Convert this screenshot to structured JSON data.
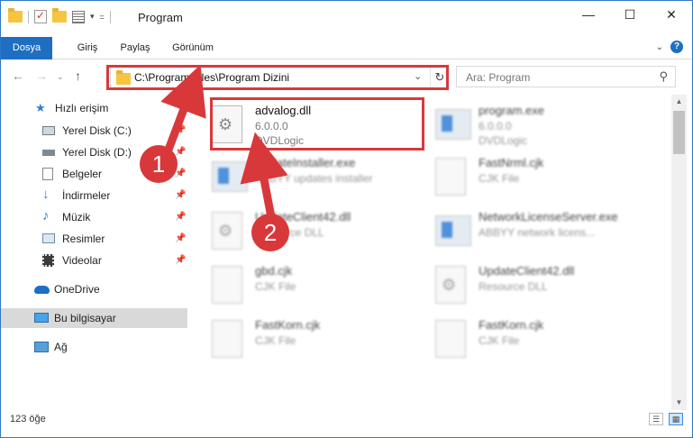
{
  "window": {
    "title": "Program"
  },
  "ribbon": {
    "tabs": [
      "Dosya",
      "Giriş",
      "Paylaş",
      "Görünüm"
    ]
  },
  "address": {
    "path": "C:\\Program Files\\Program Dizini"
  },
  "search": {
    "placeholder": "Ara: Program"
  },
  "sidebar": {
    "items": [
      {
        "label": "Hızlı erişim"
      },
      {
        "label": "Yerel Disk (C:)"
      },
      {
        "label": "Yerel Disk (D:)"
      },
      {
        "label": "Belgeler"
      },
      {
        "label": "İndirmeler"
      },
      {
        "label": "Müzik"
      },
      {
        "label": "Resimler"
      },
      {
        "label": "Videolar"
      },
      {
        "label": "OneDrive"
      },
      {
        "label": "Bu bilgisayar"
      },
      {
        "label": "Ağ"
      }
    ]
  },
  "files": [
    {
      "name": "advalog.dll",
      "line1": "6.0.0.0",
      "line2": "DVDLogic",
      "icon": "dll-icon"
    },
    {
      "name": "program.exe",
      "line1": "6.0.0.0",
      "line2": "DVDLogic",
      "icon": "exe-icon"
    },
    {
      "name": "UpdateInstaller.exe",
      "line1": "ABBYY updates installer",
      "line2": "",
      "icon": "exe-icon"
    },
    {
      "name": "FastNrml.cjk",
      "line1": "CJK File",
      "line2": "",
      "icon": "file-icon"
    },
    {
      "name": "UpdateClient42.dll",
      "line1": "Resource DLL",
      "line2": "",
      "icon": "dll-icon"
    },
    {
      "name": "NetworkLicenseServer.exe",
      "line1": "ABBYY network licens...",
      "line2": "",
      "icon": "exe-icon"
    },
    {
      "name": "gbd.cjk",
      "line1": "CJK File",
      "line2": "",
      "icon": "file-icon"
    },
    {
      "name": "UpdateClient42.dll",
      "line1": "Resource DLL",
      "line2": "",
      "icon": "dll-icon"
    },
    {
      "name": "FastKorn.cjk",
      "line1": "CJK File",
      "line2": "",
      "icon": "file-icon"
    },
    {
      "name": "FastKorn.cjk",
      "line1": "CJK File",
      "line2": "",
      "icon": "file-icon"
    }
  ],
  "status": {
    "count": "123 öğe"
  },
  "callouts": [
    "1",
    "2"
  ],
  "colors": {
    "accent": "#1e6fc2",
    "highlight": "#d9383b"
  }
}
